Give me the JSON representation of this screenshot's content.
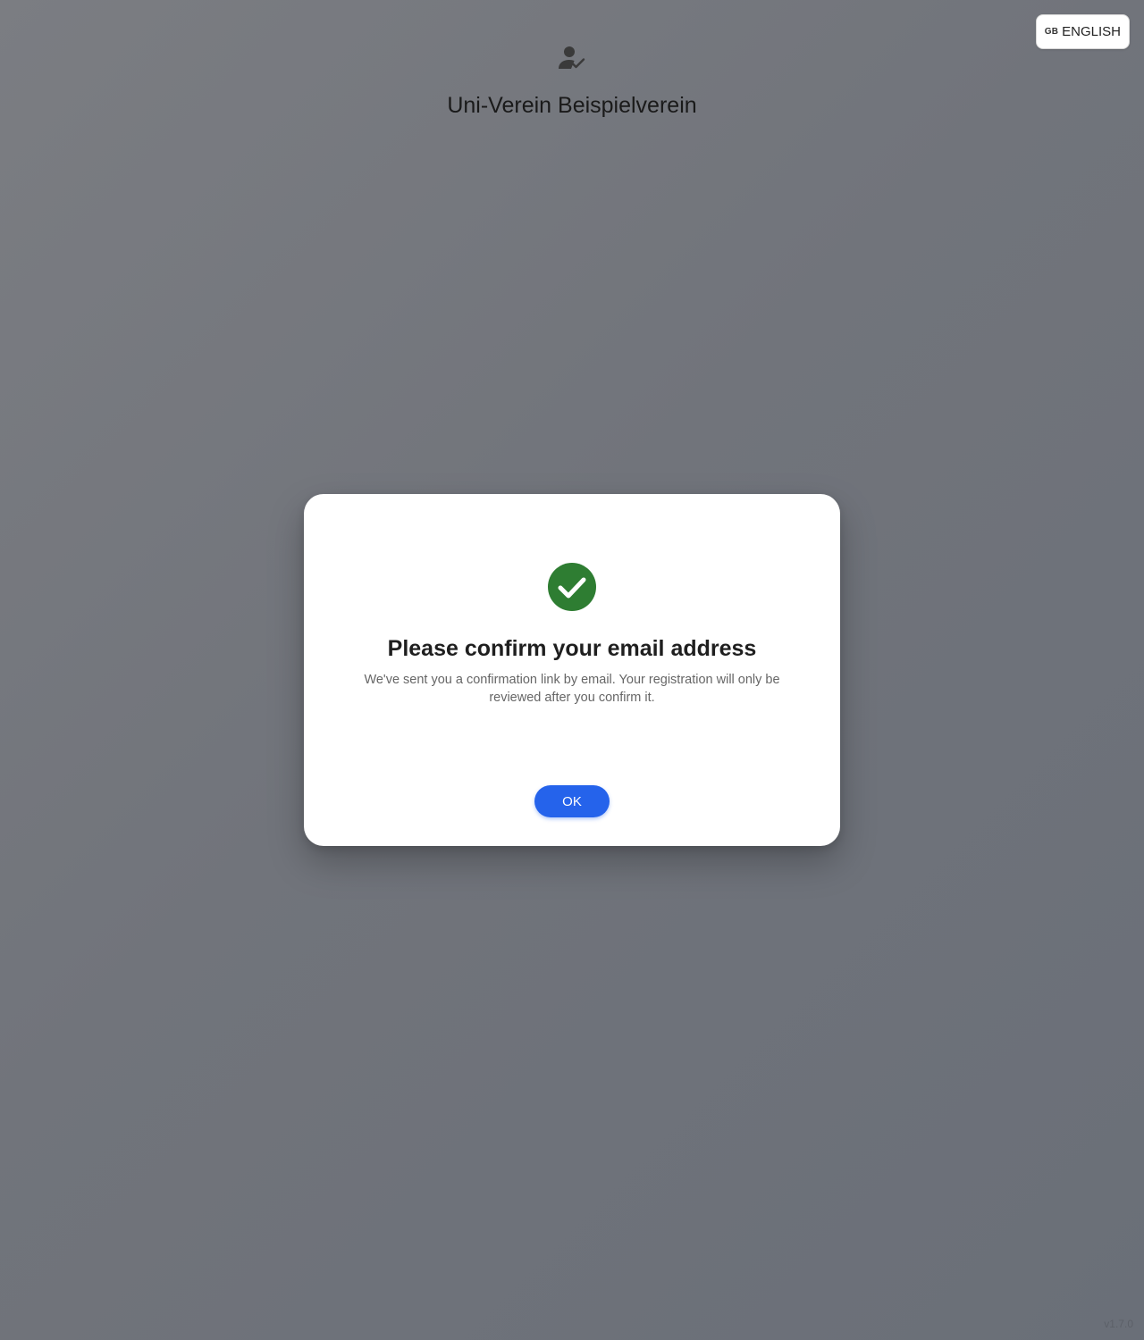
{
  "language": {
    "code": "GB",
    "label": "ENGLISH",
    "icon": "gb-flag"
  },
  "header": {
    "icon": "user-check-icon",
    "title": "Uni-Verein Beispielverein"
  },
  "modal": {
    "icon": "check-circle-icon",
    "icon_color": "#2e7d32",
    "title": "Please confirm your email address",
    "message": "We've sent you a confirmation link by email. Your registration will only be reviewed after you confirm it.",
    "ok_label": "OK",
    "button_color": "#2563eb"
  },
  "footer": {
    "version": "v1.7.0"
  }
}
